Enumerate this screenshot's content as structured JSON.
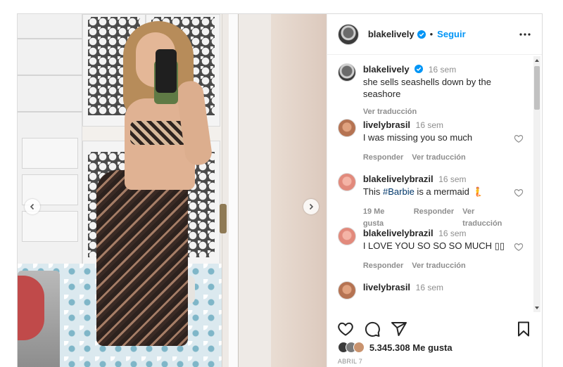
{
  "post": {
    "author": {
      "username": "blakelively",
      "verified": true,
      "separator": "•",
      "follow_label": "Seguir",
      "more_icon": "more-horizontal-icon"
    },
    "caption": {
      "username": "blakelively",
      "time": "16 sem",
      "text": "she sells seashells down by the seashore",
      "translate_label": "Ver traducción"
    },
    "comments": [
      {
        "username": "livelybrasil",
        "time": "16 sem",
        "text": "I was missing you so much",
        "likes": "",
        "reply_label": "Responder",
        "translate_label": "Ver traducción"
      },
      {
        "username": "blakelivelybrazil",
        "time": "16 sem",
        "text_prefix": "This ",
        "hashtag": "#Barbie",
        "text_suffix": " is a mermaid 🧜",
        "likes": "19 Me gusta",
        "reply_label": "Responder",
        "translate_label": "Ver traducción"
      },
      {
        "username": "blakelivelybrazil",
        "time": "16 sem",
        "text": "I LOVE YOU SO SO SO MUCH ▯▯",
        "likes": "",
        "reply_label": "Responder",
        "translate_label": "Ver traducción"
      },
      {
        "username": "livelybrasil",
        "time": "16 sem",
        "text": "",
        "likes": "",
        "reply_label": "",
        "translate_label": ""
      }
    ],
    "likes_text": "5.345.308 Me gusta",
    "date": "ABRIL 7"
  },
  "icons": [
    "heart-icon",
    "comment-icon",
    "share-icon",
    "save-icon",
    "chevron-left-icon",
    "chevron-right-icon",
    "verified-badge-icon"
  ],
  "colors": {
    "accent": "#0095f6",
    "text": "#262626",
    "muted": "#8e8e8e",
    "border": "#dbdbdb"
  }
}
